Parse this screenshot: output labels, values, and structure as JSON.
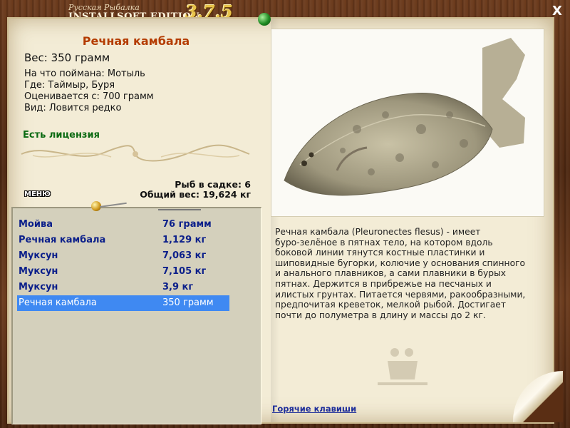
{
  "titlebar": {
    "brand_top": "Русская Рыбалка",
    "brand_bottom": "INSTALLSOFT EDITION",
    "version": "3.7.5",
    "close_label": "X"
  },
  "fish": {
    "name": "Речная камбала",
    "weight": "Вес: 350 грамм",
    "lines": [
      "На что поймана: Мотыль",
      "Где: Таймыр, Буря",
      "Оценивается с: 700 грамм",
      "Вид: Ловится редко"
    ],
    "license": "Есть лицензия"
  },
  "stats": {
    "in_cage": "Рыб в садке: 6",
    "total_weight": "Общий вес: 19,624 кг"
  },
  "menu_label": "МЕНЮ",
  "catch_list": [
    {
      "name": "Мойва",
      "amount": "76 грамм",
      "selected": false
    },
    {
      "name": "Речная камбала",
      "amount": "1,129 кг",
      "selected": false
    },
    {
      "name": "Муксун",
      "amount": "7,063 кг",
      "selected": false
    },
    {
      "name": "Муксун",
      "amount": "7,105 кг",
      "selected": false
    },
    {
      "name": "Муксун",
      "amount": "3,9 кг",
      "selected": false
    },
    {
      "name": "Речная камбала",
      "amount": "350 грамм",
      "selected": true
    }
  ],
  "description": [
    "Речная камбала (Pleuronectes flesus) - имеет",
    "буро-зелёное в пятнах тело, на котором вдоль",
    "боковой линии тянутся костные пластинки и",
    "шиповидные бугорки, колючие у основания спинного",
    "и анального плавников, а сами плавники в бурых",
    "пятнах. Держится в прибрежье на песчаных и",
    "илистых грунтах. Питается червями, ракообразными,",
    "предпочитая креветок, мелкой рыбой. Достигает",
    "почти до полуметра в длину и массы до 2 кг."
  ],
  "hotkeys_label": "Горячие клавиши",
  "icons": {
    "close": "close-icon",
    "pin_green": "green-pin-icon",
    "pin_gold": "gold-pin-icon",
    "fish_image": "flounder-image",
    "watermark": "fisherman-silhouette-icon"
  },
  "colors": {
    "title_accent": "#b43c00",
    "license": "#0b6a12",
    "list_text": "#0b1f8a",
    "selection": "#3f89f2",
    "link": "#1d2d9a"
  }
}
